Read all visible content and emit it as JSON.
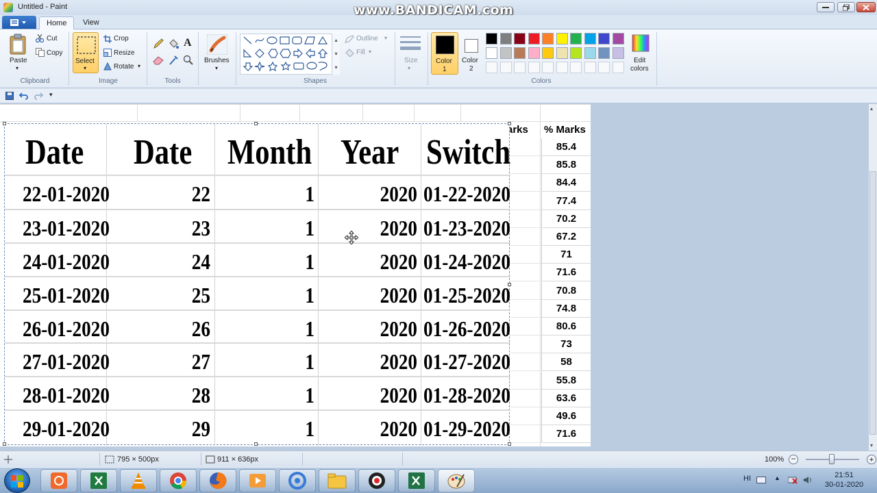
{
  "window": {
    "title": "Untitled - Paint",
    "watermark": "www.BANDICAM.com"
  },
  "tabs": [
    {
      "label": "Home",
      "active": true
    },
    {
      "label": "View",
      "active": false
    }
  ],
  "ribbon": {
    "clipboard": {
      "paste": "Paste",
      "cut": "Cut",
      "copy": "Copy",
      "label": "Clipboard"
    },
    "image": {
      "select": "Select",
      "crop": "Crop",
      "resize": "Resize",
      "rotate": "Rotate",
      "label": "Image"
    },
    "tools": {
      "label": "Tools"
    },
    "brushes": {
      "label": "Brushes"
    },
    "shapes": {
      "outline": "Outline",
      "fill": "Fill",
      "label": "Shapes"
    },
    "size": {
      "label": "Size"
    },
    "colors": {
      "color1_line1": "Color",
      "color1_line2": "1",
      "color2_line1": "Color",
      "color2_line2": "2",
      "edit_line1": "Edit",
      "edit_line2": "colors",
      "label": "Colors",
      "palette_row1": [
        "#000000",
        "#7f7f7f",
        "#880015",
        "#ed1c24",
        "#ff7f27",
        "#fff200",
        "#22b14c",
        "#00a2e8",
        "#3f48cc",
        "#a349a4"
      ],
      "palette_row2": [
        "#ffffff",
        "#c3c3c3",
        "#b97a57",
        "#ffaec9",
        "#ffc90e",
        "#efe4b0",
        "#b5e61d",
        "#99d9ea",
        "#7092be",
        "#c8bfe7"
      ],
      "color1_value": "#000000",
      "color2_value": "#ffffff"
    }
  },
  "table": {
    "headers": [
      "Date",
      "Date",
      "Month",
      "Year",
      "Switch"
    ],
    "rows": [
      [
        "22-01-2020",
        "22",
        "1",
        "2020",
        "01-22-2020"
      ],
      [
        "23-01-2020",
        "23",
        "1",
        "2020",
        "01-23-2020"
      ],
      [
        "24-01-2020",
        "24",
        "1",
        "2020",
        "01-24-2020"
      ],
      [
        "25-01-2020",
        "25",
        "1",
        "2020",
        "01-25-2020"
      ],
      [
        "26-01-2020",
        "26",
        "1",
        "2020",
        "01-26-2020"
      ],
      [
        "27-01-2020",
        "27",
        "1",
        "2020",
        "01-27-2020"
      ],
      [
        "28-01-2020",
        "28",
        "1",
        "2020",
        "01-28-2020"
      ],
      [
        "29-01-2020",
        "29",
        "1",
        "2020",
        "01-29-2020"
      ]
    ]
  },
  "background_sheet": {
    "partial_header": "arks",
    "header": "% Marks",
    "values": [
      "85.4",
      "85.8",
      "84.4",
      "77.4",
      "70.2",
      "67.2",
      "71",
      "71.6",
      "70.8",
      "74.8",
      "80.6",
      "73",
      "58",
      "55.8",
      "63.6",
      "49.6",
      "71.6"
    ]
  },
  "status": {
    "selection_size": "795 × 500px",
    "image_size": "911 × 636px",
    "zoom": "100%"
  },
  "taskbar": {
    "tray_text": "HI",
    "time": "21:51",
    "date": "30-01-2020"
  }
}
